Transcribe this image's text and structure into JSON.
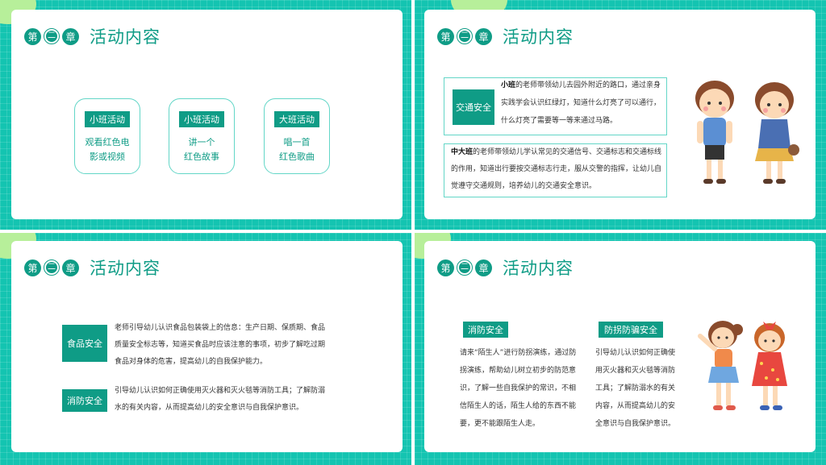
{
  "header": {
    "badges": [
      "第",
      "二",
      "章"
    ],
    "title": "活动内容"
  },
  "slide1": {
    "pills": [
      {
        "tag": "小班活动",
        "line1": "观看红色电",
        "line2": "影或视频"
      },
      {
        "tag": "小班活动",
        "line1": "讲一个",
        "line2": "红色故事"
      },
      {
        "tag": "大班活动",
        "line1": "唱一首",
        "line2": "红色歌曲"
      }
    ]
  },
  "slide2": {
    "box_label": "交通安全",
    "p1_bold": "小班",
    "p1": "的老师带领幼儿去园外附近的路口，通过亲身实践学会认识红绿灯，知道什么灯亮了可以通行，什么灯亮了需要等一等来通过马路。",
    "p2_bold": "中大班",
    "p2": "的老师带领幼儿学认常见的交通信号、交通标志和交通标线的作用，知道出行要按交通标志行走，服从交警的指挥，让幼儿自觉遵守交通规则，培养幼儿的交通安全意识。"
  },
  "slide3": {
    "item1_label": "食品安全",
    "item1_text": "老师引导幼儿认识食品包装袋上的信息：生产日期、保质期、食品质量安全标志等，知道买食品时应该注意的事项，初步了解吃过期食品对身体的危害，提高幼儿的自我保护能力。",
    "item2_label": "消防安全",
    "item2_text": "引导幼儿认识如何正确使用灭火器和灭火毯等消防工具；了解防溺水的有关内容，从而提高幼儿的安全意识与自我保护意识。"
  },
  "slide4": {
    "col1_label": "消防安全",
    "col1_text": "请来“陌生人”进行防拐演练，通过防拐演练，帮助幼儿树立初步的防范意识，了解一些自我保护的常识，不相信陌生人的话，陌生人给的东西不能要，更不能跟陌生人走。",
    "col2_label": "防拐防骗安全",
    "col2_text": "引导幼儿认识如何正确使用灭火器和灭火毯等消防工具；了解防溺水的有关内容，从而提高幼儿的安全意识与自我保护意识。"
  },
  "colors": {
    "teal": "#14c4b1",
    "dark_teal": "#0f9c86",
    "light_green": "#b7ef9a"
  }
}
